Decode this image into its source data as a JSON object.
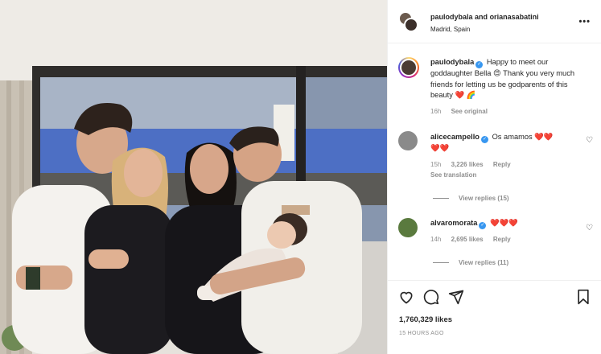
{
  "post": {
    "header": {
      "user_a": "paulodybala",
      "joiner": "and",
      "user_b": "orianasabatini",
      "location": "Madrid, Spain",
      "more_label": "•••"
    },
    "caption": {
      "username": "paulodybala",
      "verified_mark": "✓",
      "text_1": "Happy to meet our goddaughter Bella 😍 Thank you very much friends for letting us be godparents of this beauty",
      "hearts": "❤️ 🌈",
      "time": "16h",
      "see_original": "See original"
    },
    "comments": [
      {
        "username": "alicecampello",
        "verified_mark": "✓",
        "text": "Os amamos ❤️❤️",
        "text_2": "❤️❤️",
        "time": "15h",
        "likes": "3,226 likes",
        "reply": "Reply",
        "see_translation": "See translation",
        "view_replies": "View replies (15)"
      },
      {
        "username": "alvaromorata",
        "verified_mark": "✓",
        "text": "❤️❤️❤️",
        "time": "14h",
        "likes": "2,695 likes",
        "reply": "Reply",
        "view_replies": "View replies (11)"
      }
    ],
    "likes_count": "1,760,329 likes",
    "posted_ago": "15 HOURS AGO",
    "icons": {
      "like": "heart-icon",
      "comment": "comment-icon",
      "share": "paper-plane-icon",
      "save": "bookmark-icon"
    }
  }
}
